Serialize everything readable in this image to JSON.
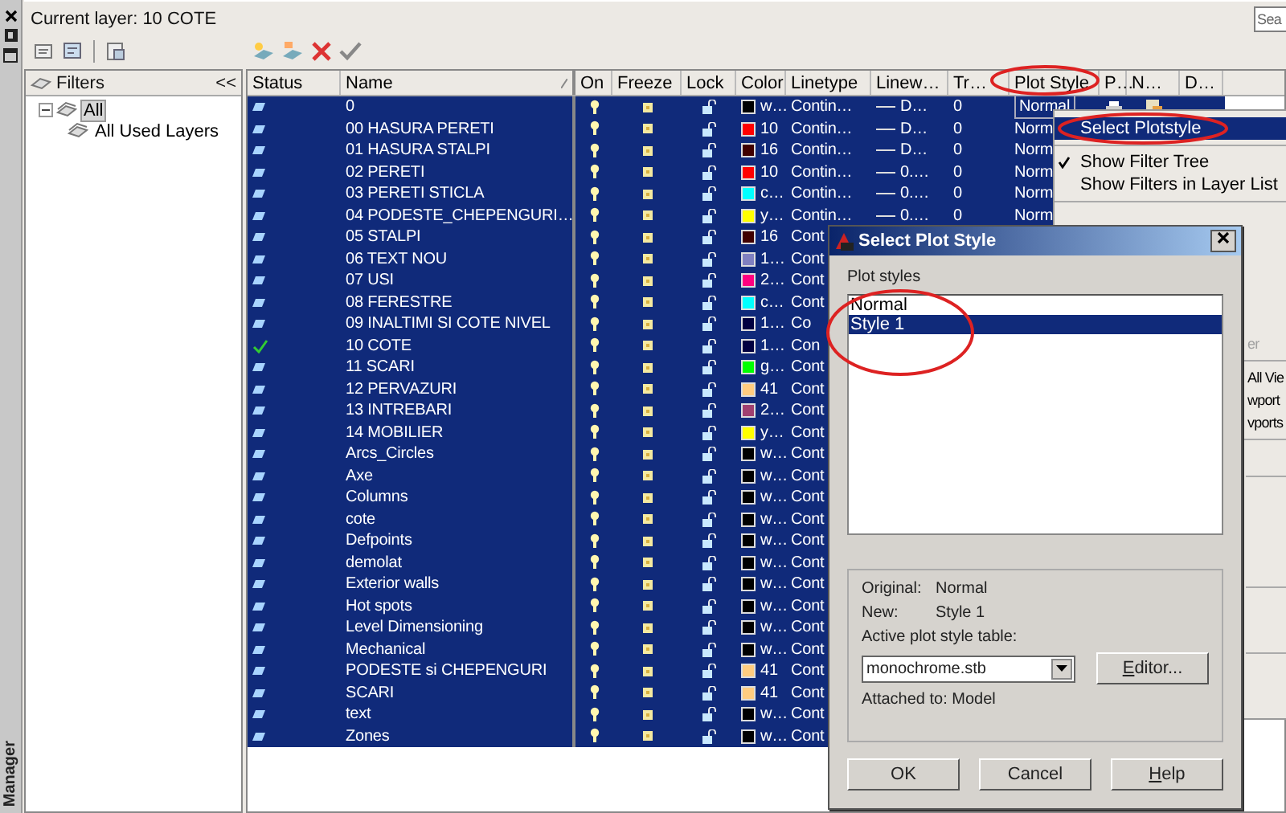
{
  "palette": {
    "title": "Manager"
  },
  "current_layer": "Current layer: 10 COTE",
  "search": {
    "placeholder": "Sea"
  },
  "filters": {
    "title": "Filters",
    "collapse": "<<",
    "tree": [
      {
        "label": "All",
        "selected": true,
        "expanded": true,
        "children": [
          {
            "label": "All Used Layers",
            "selected": false
          }
        ]
      }
    ]
  },
  "columns": [
    "Status",
    "Name",
    "On",
    "Freeze",
    "Lock",
    "Color",
    "Linetype",
    "Linew…",
    "Tr…",
    "Plot Style",
    "P…",
    "N…",
    "D…"
  ],
  "rows": [
    {
      "name": "0",
      "selected": true,
      "current": false,
      "on": true,
      "frozen": false,
      "locked": false,
      "color": "#000000",
      "color_label": "w…",
      "linetype": "Contin…",
      "lineweight": "D…",
      "transparency": "0",
      "plot_style": "Normal",
      "editing": true,
      "plot": true,
      "vp_freeze": false
    },
    {
      "name": "00 HASURA PERETI",
      "selected": true,
      "current": false,
      "on": true,
      "frozen": false,
      "locked": false,
      "color": "#ff0000",
      "color_label": "10",
      "linetype": "Contin…",
      "lineweight": "D…",
      "transparency": "0",
      "plot_style": "Norm"
    },
    {
      "name": "01 HASURA STALPI",
      "selected": true,
      "current": false,
      "on": true,
      "frozen": false,
      "locked": false,
      "color": "#400000",
      "color_label": "16",
      "linetype": "Contin…",
      "lineweight": "D…",
      "transparency": "0",
      "plot_style": "Norm"
    },
    {
      "name": "02 PERETI",
      "selected": true,
      "current": false,
      "on": true,
      "frozen": false,
      "locked": false,
      "color": "#ff0000",
      "color_label": "10",
      "linetype": "Contin…",
      "lineweight": "0.…",
      "transparency": "0",
      "plot_style": "Norm"
    },
    {
      "name": "03 PERETI STICLA",
      "selected": true,
      "current": false,
      "on": true,
      "frozen": false,
      "locked": false,
      "color": "#00ffff",
      "color_label": "c…",
      "linetype": "Contin…",
      "lineweight": "0.…",
      "transparency": "0",
      "plot_style": "Norm"
    },
    {
      "name": "04 PODESTE_CHEPENGURI…",
      "selected": true,
      "current": false,
      "on": true,
      "frozen": false,
      "locked": false,
      "color": "#ffff00",
      "color_label": "y…",
      "linetype": "Contin…",
      "lineweight": "0.…",
      "transparency": "0",
      "plot_style": "Norm"
    },
    {
      "name": "05 STALPI",
      "selected": true,
      "current": false,
      "on": true,
      "frozen": false,
      "locked": false,
      "color": "#400000",
      "color_label": "16",
      "linetype": "Cont"
    },
    {
      "name": "06 TEXT NOU",
      "selected": true,
      "current": false,
      "on": true,
      "frozen": false,
      "locked": false,
      "color": "#8080c0",
      "color_label": "1…",
      "linetype": "Cont"
    },
    {
      "name": "07 USI",
      "selected": true,
      "current": false,
      "on": true,
      "frozen": false,
      "locked": false,
      "color": "#ff0080",
      "color_label": "2…",
      "linetype": "Cont"
    },
    {
      "name": "08 FERESTRE",
      "selected": true,
      "current": false,
      "on": true,
      "frozen": false,
      "locked": false,
      "color": "#00ffff",
      "color_label": "c…",
      "linetype": "Cont"
    },
    {
      "name": "09 INALTIMI SI COTE NIVEL",
      "selected": true,
      "current": false,
      "on": true,
      "frozen": false,
      "locked": false,
      "color": "#000040",
      "color_label": "1…",
      "linetype": "Co"
    },
    {
      "name": "10 COTE",
      "selected": true,
      "current": true,
      "on": true,
      "frozen": false,
      "locked": false,
      "color": "#000040",
      "color_label": "1…",
      "linetype": "Con"
    },
    {
      "name": "11 SCARI",
      "selected": true,
      "current": false,
      "on": true,
      "frozen": false,
      "locked": false,
      "color": "#00ff00",
      "color_label": "g…",
      "linetype": "Cont"
    },
    {
      "name": "12 PERVAZURI",
      "selected": true,
      "current": false,
      "on": true,
      "frozen": false,
      "locked": false,
      "color": "#ffcc80",
      "color_label": "41",
      "linetype": "Cont"
    },
    {
      "name": "13 INTREBARI",
      "selected": true,
      "current": false,
      "on": true,
      "frozen": false,
      "locked": false,
      "color": "#a04070",
      "color_label": "2…",
      "linetype": "Cont"
    },
    {
      "name": "14 MOBILIER",
      "selected": true,
      "current": false,
      "on": true,
      "frozen": false,
      "locked": false,
      "color": "#ffff00",
      "color_label": "y…",
      "linetype": "Cont"
    },
    {
      "name": "Arcs_Circles",
      "selected": true,
      "current": false,
      "on": true,
      "frozen": false,
      "locked": false,
      "color": "#000000",
      "color_label": "w…",
      "linetype": "Cont"
    },
    {
      "name": "Axe",
      "selected": true,
      "current": false,
      "on": true,
      "frozen": false,
      "locked": false,
      "color": "#000000",
      "color_label": "w…",
      "linetype": "Cont"
    },
    {
      "name": "Columns",
      "selected": true,
      "current": false,
      "on": true,
      "frozen": false,
      "locked": false,
      "color": "#000000",
      "color_label": "w…",
      "linetype": "Cont"
    },
    {
      "name": "cote",
      "selected": true,
      "current": false,
      "on": true,
      "frozen": false,
      "locked": false,
      "color": "#000000",
      "color_label": "w…",
      "linetype": "Cont"
    },
    {
      "name": "Defpoints",
      "selected": true,
      "current": false,
      "on": true,
      "frozen": false,
      "locked": false,
      "color": "#000000",
      "color_label": "w…",
      "linetype": "Cont"
    },
    {
      "name": "demolat",
      "selected": true,
      "current": false,
      "on": true,
      "frozen": false,
      "locked": false,
      "color": "#000000",
      "color_label": "w…",
      "linetype": "Cont"
    },
    {
      "name": "Exterior walls",
      "selected": true,
      "current": false,
      "on": true,
      "frozen": false,
      "locked": false,
      "color": "#000000",
      "color_label": "w…",
      "linetype": "Cont"
    },
    {
      "name": "Hot spots",
      "selected": true,
      "current": false,
      "on": true,
      "frozen": false,
      "locked": false,
      "color": "#000000",
      "color_label": "w…",
      "linetype": "Cont"
    },
    {
      "name": "Level Dimensioning",
      "selected": true,
      "current": false,
      "on": true,
      "frozen": false,
      "locked": false,
      "color": "#000000",
      "color_label": "w…",
      "linetype": "Cont"
    },
    {
      "name": "Mechanical",
      "selected": true,
      "current": false,
      "on": true,
      "frozen": false,
      "locked": false,
      "color": "#000000",
      "color_label": "w…",
      "linetype": "Cont"
    },
    {
      "name": "PODESTE si CHEPENGURI",
      "selected": true,
      "current": false,
      "on": true,
      "frozen": false,
      "locked": false,
      "color": "#ffcc80",
      "color_label": "41",
      "linetype": "Cont"
    },
    {
      "name": "SCARI",
      "selected": true,
      "current": false,
      "on": true,
      "frozen": false,
      "locked": false,
      "color": "#ffcc80",
      "color_label": "41",
      "linetype": "Cont"
    },
    {
      "name": "text",
      "selected": true,
      "current": false,
      "on": true,
      "frozen": false,
      "locked": false,
      "color": "#000000",
      "color_label": "w…",
      "linetype": "Cont"
    },
    {
      "name": "Zones",
      "selected": true,
      "current": false,
      "on": true,
      "frozen": false,
      "locked": false,
      "color": "#000000",
      "color_label": "w…",
      "linetype": "Cont"
    }
  ],
  "context_menu": {
    "items": [
      {
        "kind": "item",
        "label": "Select Plotstyle",
        "selected": true,
        "checked": false,
        "disabled": false
      },
      {
        "kind": "separator"
      },
      {
        "kind": "item",
        "label": "Show Filter Tree",
        "selected": false,
        "checked": true,
        "disabled": false
      },
      {
        "kind": "item",
        "label": "Show Filters in Layer List",
        "selected": false,
        "checked": false,
        "disabled": false
      },
      {
        "kind": "separator"
      }
    ],
    "partial_items": [
      {
        "kind": "item",
        "label": "er",
        "disabled": true
      },
      {
        "kind": "separator"
      },
      {
        "kind": "item",
        "label": "All Vie",
        "disabled": false
      },
      {
        "kind": "item",
        "label": "wport",
        "disabled": false
      },
      {
        "kind": "item",
        "label": "vports",
        "disabled": false
      },
      {
        "kind": "separator"
      }
    ]
  },
  "dialog": {
    "title": "Select Plot Style",
    "list_label": "Plot styles",
    "styles": [
      {
        "name": "Normal",
        "selected": false
      },
      {
        "name": "Style 1",
        "selected": true
      }
    ],
    "original_label": "Original:",
    "original": "Normal",
    "new_label": "New:",
    "new": "Style 1",
    "table_label": "Active plot style table:",
    "table_value": "monochrome.stb",
    "editor_button": {
      "label": "Editor...",
      "mnemonic": true
    },
    "attached": "Attached to: Model",
    "buttons": [
      {
        "label": "OK",
        "mnemonic": false
      },
      {
        "label": "Cancel",
        "mnemonic": false
      },
      {
        "label": "Help",
        "mnemonic": true
      }
    ]
  }
}
